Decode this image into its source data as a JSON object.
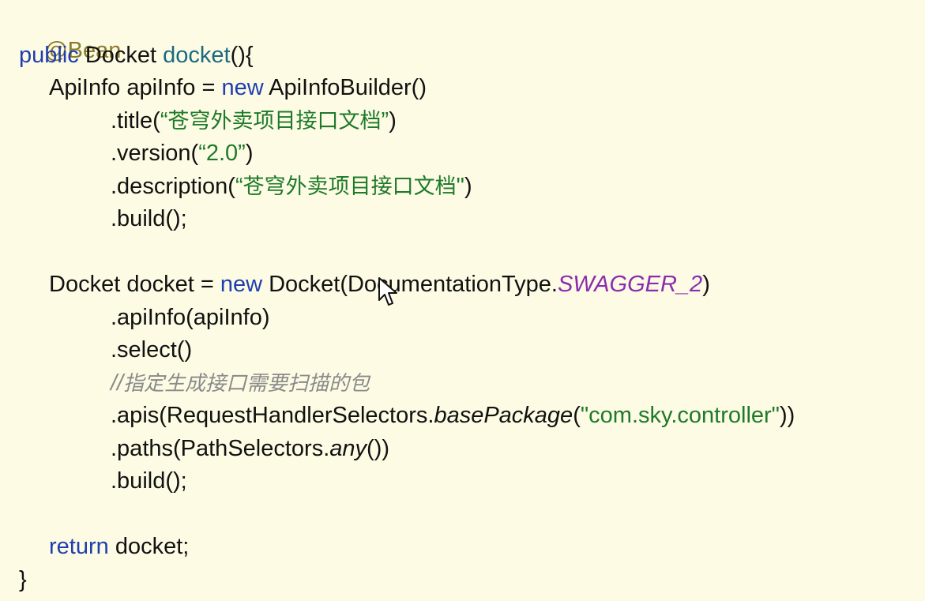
{
  "code": {
    "l1": {
      "annotation": "@Bean"
    },
    "l2": {
      "kw": "public",
      "type": " Docket ",
      "method": "docket",
      "rest": "(){"
    },
    "l3": {
      "a": "ApiInfo apiInfo = ",
      "kw": "new",
      "b": " ApiInfoBuilder()"
    },
    "l4": {
      "a": ".title(",
      "open": "“",
      "str": "苍穹外卖项目接口文档",
      "close": "”",
      "b": ")"
    },
    "l5": {
      "a": ".version(",
      "str": "“2.0”",
      "b": ")"
    },
    "l6": {
      "a": ".description(",
      "open": "“",
      "str": "苍穹外卖项目接口文档",
      "close": "\"",
      "b": ")"
    },
    "l7": {
      "a": ".build();"
    },
    "l8": {
      "a": "Docket docket = ",
      "kw": "new",
      "b": " Docket(DocumentationType.",
      "const": "SWAGGER_2",
      "c": ")"
    },
    "l9": {
      "a": ".apiInfo(apiInfo)"
    },
    "l10": {
      "a": ".select()"
    },
    "l11": {
      "slashes": "//",
      "comment": "指定生成接口需要扫描的包"
    },
    "l12": {
      "a": ".apis(RequestHandlerSelectors.",
      "it": "basePackage",
      "b": "(",
      "str": "\"com.sky.controller\"",
      "c": "))"
    },
    "l13": {
      "a": ".paths(PathSelectors.",
      "it": "any",
      "b": "())"
    },
    "l14": {
      "a": ".build();"
    },
    "l15": {
      "kw": "return",
      "a": " docket;"
    },
    "l16": {
      "a": "}"
    }
  },
  "colors": {
    "background": "#FDFBE4",
    "keyword": "#1F3FB0",
    "method": "#1A6A80",
    "string": "#1E7A2A",
    "annotation": "#8C7A2C",
    "constant": "#8A2BB0",
    "comment": "#8A8A8A"
  },
  "icons": {
    "cursor": "mouse-pointer-icon"
  }
}
